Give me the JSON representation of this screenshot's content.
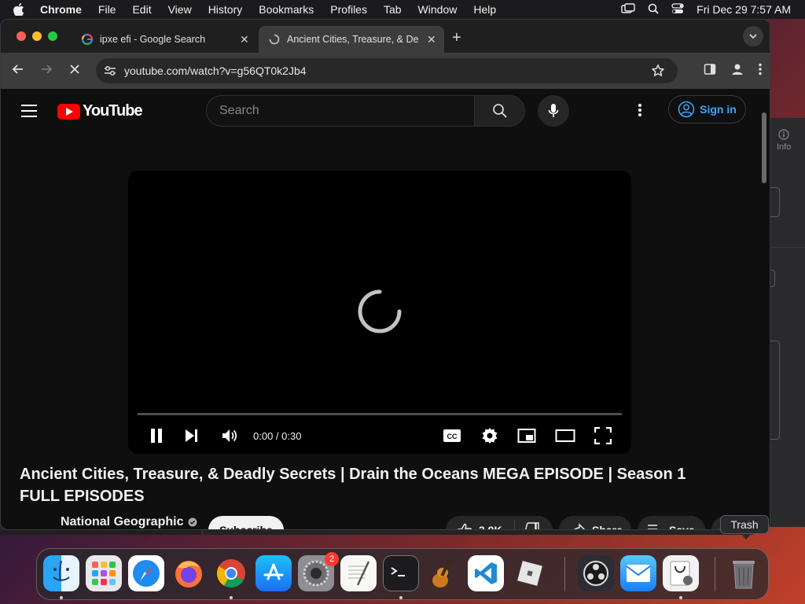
{
  "menubar": {
    "app_name": "Chrome",
    "menus": [
      "File",
      "Edit",
      "View",
      "History",
      "Bookmarks",
      "Profiles",
      "Tab",
      "Window",
      "Help"
    ],
    "clock": "Fri Dec 29  7:57 AM"
  },
  "background_window": {
    "info_label": "Info"
  },
  "browser": {
    "tabs": [
      {
        "title": "ipxe efi - Google Search",
        "favicon": "google-icon",
        "active": false
      },
      {
        "title": "Ancient Cities, Treasure, & De",
        "favicon": "loading-icon",
        "active": true
      }
    ],
    "url": "youtube.com/watch?v=g56QT0k2Jb4"
  },
  "youtube": {
    "logo_text": "YouTube",
    "search_placeholder": "Search",
    "signin_label": "Sign in",
    "player": {
      "time": "0:00 / 0:30",
      "progress": 0
    },
    "video_title": "Ancient Cities, Treasure, & Deadly Secrets | Drain the Oceans MEGA EPISODE | Season 1 FULL EPISODES",
    "channel_name": "National Geographic",
    "subscribe_label": "Subscribe",
    "like_count": "3.9K",
    "share_label": "Share",
    "save_label": "Save"
  },
  "dock": {
    "tooltip": "Trash",
    "apps": [
      {
        "name": "finder-icon",
        "running": true
      },
      {
        "name": "launchpad-icon",
        "running": false
      },
      {
        "name": "safari-icon",
        "running": false
      },
      {
        "name": "firefox-icon",
        "running": false
      },
      {
        "name": "chrome-icon",
        "running": true
      },
      {
        "name": "app-store-icon",
        "running": false
      },
      {
        "name": "system-settings-icon",
        "running": false,
        "badge": "2"
      },
      {
        "name": "textedit-icon",
        "running": false
      },
      {
        "name": "terminal-icon",
        "running": true
      },
      {
        "name": "garageband-icon",
        "running": false
      },
      {
        "name": "vscode-icon",
        "running": false
      },
      {
        "name": "roblox-icon",
        "running": false
      },
      {
        "name": "obs-icon",
        "running": false
      },
      {
        "name": "mail-icon",
        "running": false
      },
      {
        "name": "system-information-icon",
        "running": true
      },
      {
        "name": "trash-icon",
        "running": false
      }
    ]
  },
  "colors": {
    "youtube_red": "#ff0000",
    "youtube_bg": "#0f0f0f",
    "link_blue": "#3ea6ff",
    "traffic_red": "#ff5f57",
    "traffic_yellow": "#febc2e",
    "traffic_green": "#28c840"
  }
}
